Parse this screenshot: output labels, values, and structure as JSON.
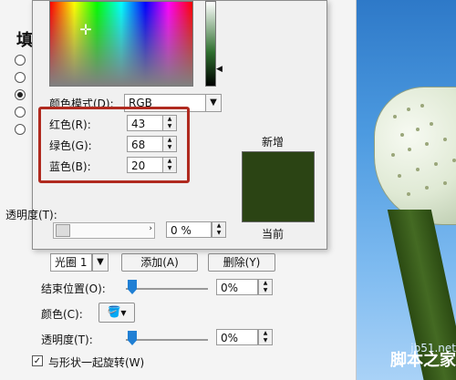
{
  "format_panel": {
    "title": "填",
    "stop_select": {
      "value": "光圈 1"
    },
    "add_button": "添加(A)",
    "delete_button": "删除(Y)",
    "end_position_label": "结束位置(O):",
    "end_position_value": "0%",
    "color_label": "颜色(C):",
    "transparency_label": "透明度(T):",
    "transparency_value": "0%",
    "rotate_label": "与形状一起旋转(W)",
    "rotate_checked": true
  },
  "color_dialog": {
    "mode_label": "颜色模式(D):",
    "mode_value": "RGB",
    "red_label": "红色(R):",
    "red_value": "43",
    "green_label": "绿色(G):",
    "green_value": "68",
    "blue_label": "蓝色(B):",
    "blue_value": "20",
    "new_label": "新增",
    "current_label": "当前",
    "transparency_label": "透明度(T):",
    "transparency_value": "0 %",
    "current_color": "#2b4414"
  },
  "watermark": {
    "site": "jb51.net",
    "brand": "脚本之家"
  },
  "colors": {
    "highlight": "#b02a1f",
    "slider": "#1f7fd4"
  }
}
